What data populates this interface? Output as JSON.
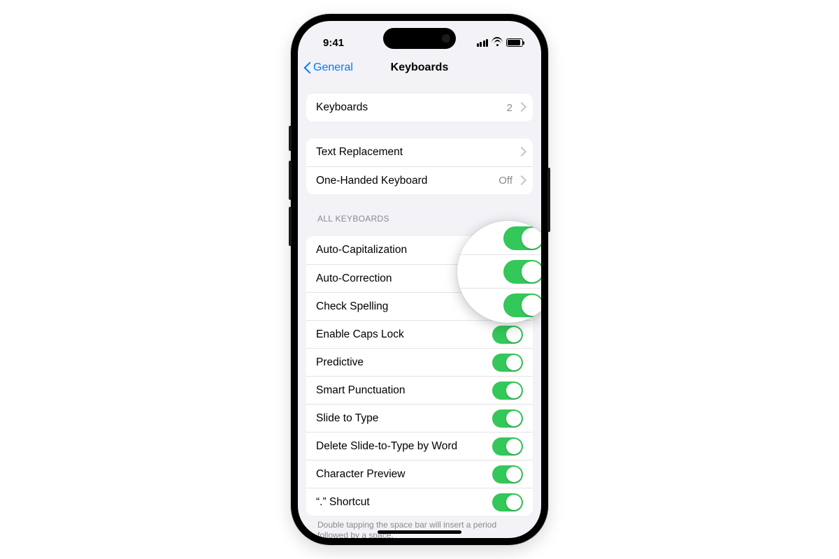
{
  "statusbar": {
    "time": "9:41"
  },
  "nav": {
    "back_label": "General",
    "title": "Keyboards"
  },
  "group1": {
    "keyboards_label": "Keyboards",
    "keyboards_count": "2"
  },
  "group2": {
    "text_replacement_label": "Text Replacement",
    "one_handed_label": "One-Handed Keyboard",
    "one_handed_value": "Off"
  },
  "toggles_header": "ALL KEYBOARDS",
  "toggles": [
    {
      "label": "Auto-Capitalization",
      "on": true
    },
    {
      "label": "Auto-Correction",
      "on": true
    },
    {
      "label": "Check Spelling",
      "on": true
    },
    {
      "label": "Enable Caps Lock",
      "on": true
    },
    {
      "label": "Predictive",
      "on": true
    },
    {
      "label": "Smart Punctuation",
      "on": true
    },
    {
      "label": "Slide to Type",
      "on": true
    },
    {
      "label": "Delete Slide-to-Type by Word",
      "on": true
    },
    {
      "label": "Character Preview",
      "on": true
    },
    {
      "label": "“.” Shortcut",
      "on": true
    }
  ],
  "footer_note": "Double tapping the space bar will insert a period followed by a space.",
  "colors": {
    "accent": "#007aff",
    "toggle_on": "#34c759",
    "bg": "#f2f2f7"
  }
}
